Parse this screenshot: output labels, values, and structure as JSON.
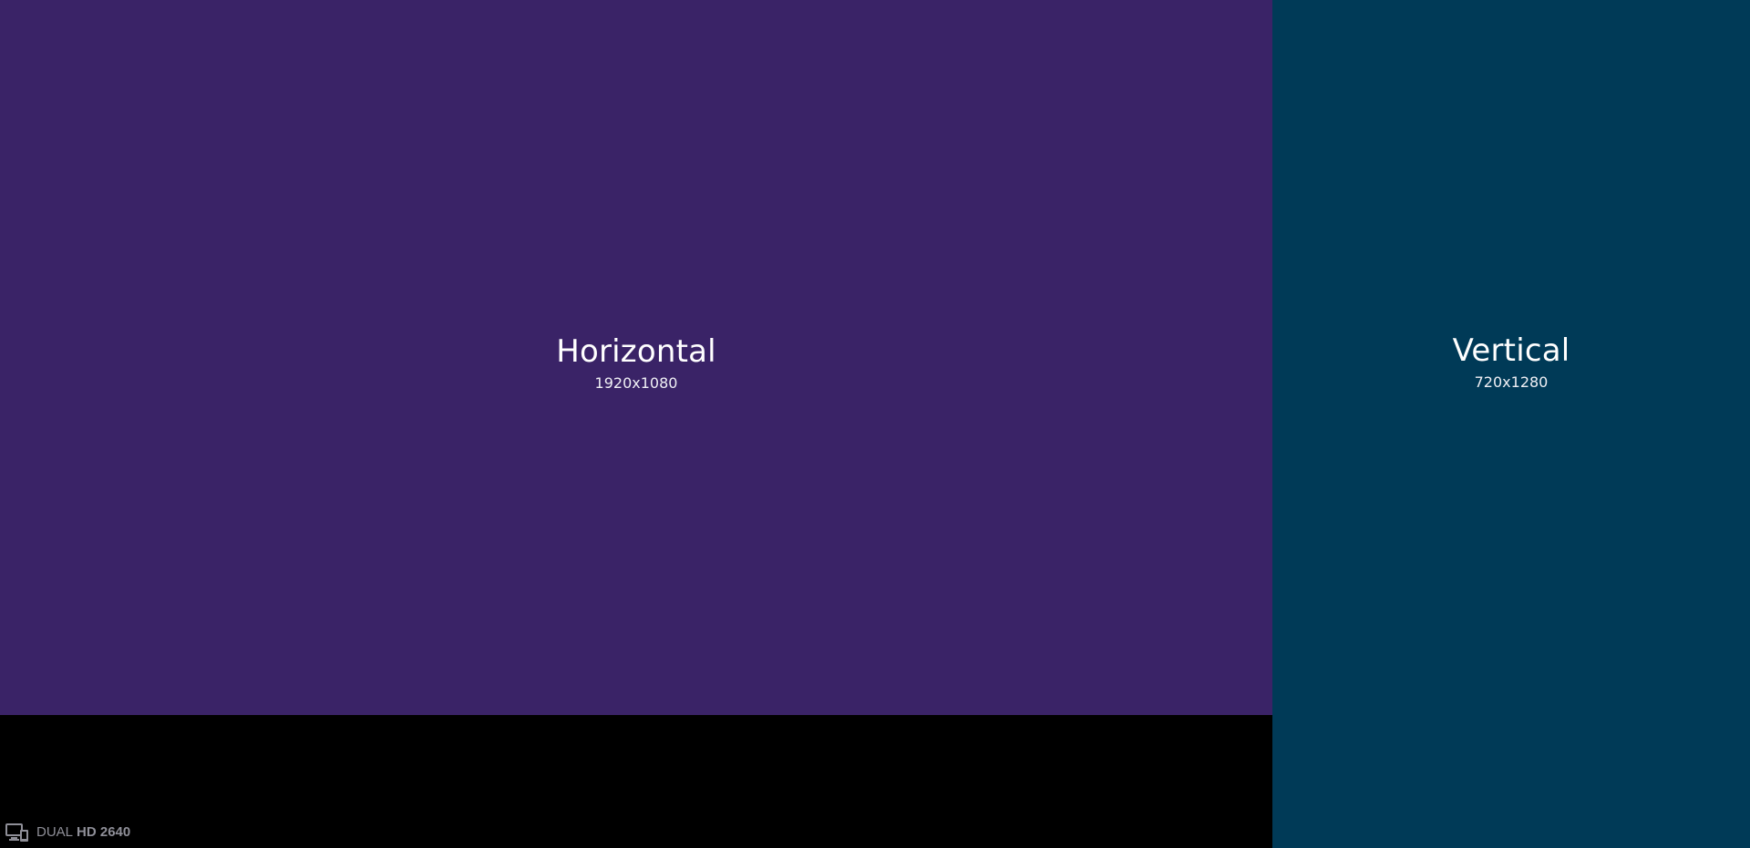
{
  "zones": {
    "horizontal": {
      "title": "Horizontal",
      "resolution": "1920x1080",
      "color": "#3a2367"
    },
    "vertical": {
      "title": "Vertical",
      "resolution": "720x1280",
      "color": "#003a57"
    }
  },
  "badge": {
    "icon": "dual-display-icon",
    "prefix": "DUAL",
    "suffix": "HD 2640"
  }
}
